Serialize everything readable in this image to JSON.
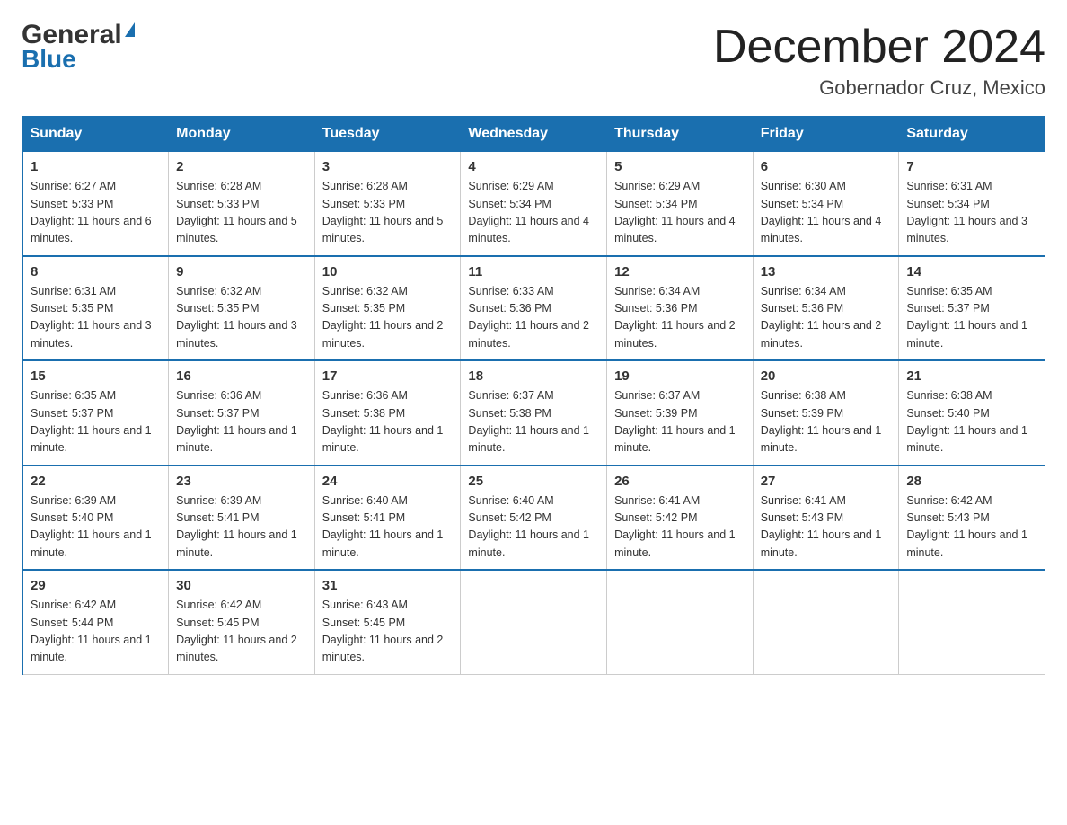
{
  "logo": {
    "text_general": "General",
    "text_blue": "Blue"
  },
  "title": "December 2024",
  "location": "Gobernador Cruz, Mexico",
  "days_of_week": [
    "Sunday",
    "Monday",
    "Tuesday",
    "Wednesday",
    "Thursday",
    "Friday",
    "Saturday"
  ],
  "weeks": [
    [
      {
        "day": "1",
        "sunrise": "Sunrise: 6:27 AM",
        "sunset": "Sunset: 5:33 PM",
        "daylight": "Daylight: 11 hours and 6 minutes."
      },
      {
        "day": "2",
        "sunrise": "Sunrise: 6:28 AM",
        "sunset": "Sunset: 5:33 PM",
        "daylight": "Daylight: 11 hours and 5 minutes."
      },
      {
        "day": "3",
        "sunrise": "Sunrise: 6:28 AM",
        "sunset": "Sunset: 5:33 PM",
        "daylight": "Daylight: 11 hours and 5 minutes."
      },
      {
        "day": "4",
        "sunrise": "Sunrise: 6:29 AM",
        "sunset": "Sunset: 5:34 PM",
        "daylight": "Daylight: 11 hours and 4 minutes."
      },
      {
        "day": "5",
        "sunrise": "Sunrise: 6:29 AM",
        "sunset": "Sunset: 5:34 PM",
        "daylight": "Daylight: 11 hours and 4 minutes."
      },
      {
        "day": "6",
        "sunrise": "Sunrise: 6:30 AM",
        "sunset": "Sunset: 5:34 PM",
        "daylight": "Daylight: 11 hours and 4 minutes."
      },
      {
        "day": "7",
        "sunrise": "Sunrise: 6:31 AM",
        "sunset": "Sunset: 5:34 PM",
        "daylight": "Daylight: 11 hours and 3 minutes."
      }
    ],
    [
      {
        "day": "8",
        "sunrise": "Sunrise: 6:31 AM",
        "sunset": "Sunset: 5:35 PM",
        "daylight": "Daylight: 11 hours and 3 minutes."
      },
      {
        "day": "9",
        "sunrise": "Sunrise: 6:32 AM",
        "sunset": "Sunset: 5:35 PM",
        "daylight": "Daylight: 11 hours and 3 minutes."
      },
      {
        "day": "10",
        "sunrise": "Sunrise: 6:32 AM",
        "sunset": "Sunset: 5:35 PM",
        "daylight": "Daylight: 11 hours and 2 minutes."
      },
      {
        "day": "11",
        "sunrise": "Sunrise: 6:33 AM",
        "sunset": "Sunset: 5:36 PM",
        "daylight": "Daylight: 11 hours and 2 minutes."
      },
      {
        "day": "12",
        "sunrise": "Sunrise: 6:34 AM",
        "sunset": "Sunset: 5:36 PM",
        "daylight": "Daylight: 11 hours and 2 minutes."
      },
      {
        "day": "13",
        "sunrise": "Sunrise: 6:34 AM",
        "sunset": "Sunset: 5:36 PM",
        "daylight": "Daylight: 11 hours and 2 minutes."
      },
      {
        "day": "14",
        "sunrise": "Sunrise: 6:35 AM",
        "sunset": "Sunset: 5:37 PM",
        "daylight": "Daylight: 11 hours and 1 minute."
      }
    ],
    [
      {
        "day": "15",
        "sunrise": "Sunrise: 6:35 AM",
        "sunset": "Sunset: 5:37 PM",
        "daylight": "Daylight: 11 hours and 1 minute."
      },
      {
        "day": "16",
        "sunrise": "Sunrise: 6:36 AM",
        "sunset": "Sunset: 5:37 PM",
        "daylight": "Daylight: 11 hours and 1 minute."
      },
      {
        "day": "17",
        "sunrise": "Sunrise: 6:36 AM",
        "sunset": "Sunset: 5:38 PM",
        "daylight": "Daylight: 11 hours and 1 minute."
      },
      {
        "day": "18",
        "sunrise": "Sunrise: 6:37 AM",
        "sunset": "Sunset: 5:38 PM",
        "daylight": "Daylight: 11 hours and 1 minute."
      },
      {
        "day": "19",
        "sunrise": "Sunrise: 6:37 AM",
        "sunset": "Sunset: 5:39 PM",
        "daylight": "Daylight: 11 hours and 1 minute."
      },
      {
        "day": "20",
        "sunrise": "Sunrise: 6:38 AM",
        "sunset": "Sunset: 5:39 PM",
        "daylight": "Daylight: 11 hours and 1 minute."
      },
      {
        "day": "21",
        "sunrise": "Sunrise: 6:38 AM",
        "sunset": "Sunset: 5:40 PM",
        "daylight": "Daylight: 11 hours and 1 minute."
      }
    ],
    [
      {
        "day": "22",
        "sunrise": "Sunrise: 6:39 AM",
        "sunset": "Sunset: 5:40 PM",
        "daylight": "Daylight: 11 hours and 1 minute."
      },
      {
        "day": "23",
        "sunrise": "Sunrise: 6:39 AM",
        "sunset": "Sunset: 5:41 PM",
        "daylight": "Daylight: 11 hours and 1 minute."
      },
      {
        "day": "24",
        "sunrise": "Sunrise: 6:40 AM",
        "sunset": "Sunset: 5:41 PM",
        "daylight": "Daylight: 11 hours and 1 minute."
      },
      {
        "day": "25",
        "sunrise": "Sunrise: 6:40 AM",
        "sunset": "Sunset: 5:42 PM",
        "daylight": "Daylight: 11 hours and 1 minute."
      },
      {
        "day": "26",
        "sunrise": "Sunrise: 6:41 AM",
        "sunset": "Sunset: 5:42 PM",
        "daylight": "Daylight: 11 hours and 1 minute."
      },
      {
        "day": "27",
        "sunrise": "Sunrise: 6:41 AM",
        "sunset": "Sunset: 5:43 PM",
        "daylight": "Daylight: 11 hours and 1 minute."
      },
      {
        "day": "28",
        "sunrise": "Sunrise: 6:42 AM",
        "sunset": "Sunset: 5:43 PM",
        "daylight": "Daylight: 11 hours and 1 minute."
      }
    ],
    [
      {
        "day": "29",
        "sunrise": "Sunrise: 6:42 AM",
        "sunset": "Sunset: 5:44 PM",
        "daylight": "Daylight: 11 hours and 1 minute."
      },
      {
        "day": "30",
        "sunrise": "Sunrise: 6:42 AM",
        "sunset": "Sunset: 5:45 PM",
        "daylight": "Daylight: 11 hours and 2 minutes."
      },
      {
        "day": "31",
        "sunrise": "Sunrise: 6:43 AM",
        "sunset": "Sunset: 5:45 PM",
        "daylight": "Daylight: 11 hours and 2 minutes."
      },
      null,
      null,
      null,
      null
    ]
  ]
}
